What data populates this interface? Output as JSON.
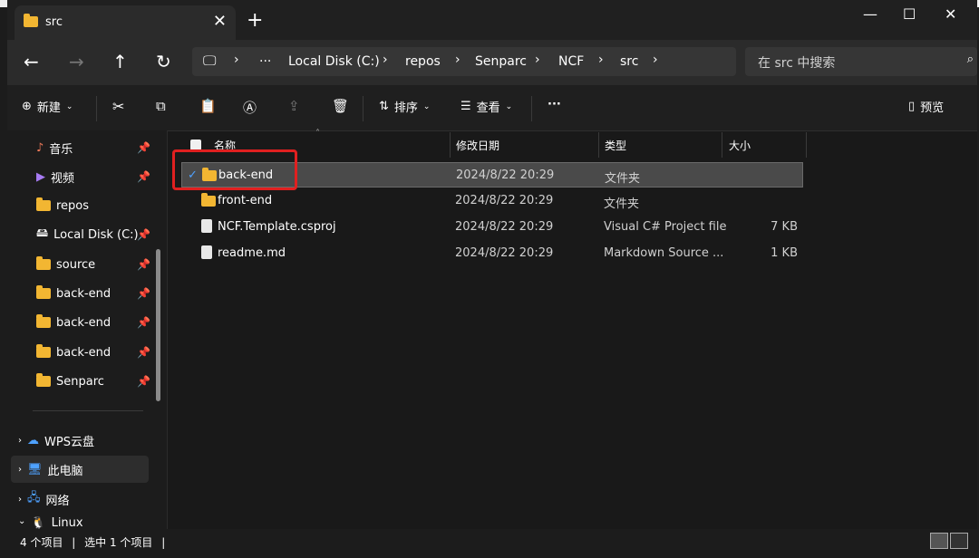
{
  "tab": {
    "title": "src"
  },
  "address": {
    "crumbs": [
      "Local Disk (C:)",
      "repos",
      "Senparc",
      "NCF",
      "src"
    ],
    "more": "···"
  },
  "search": {
    "placeholder": "在 src 中搜索"
  },
  "toolbar": {
    "new_label": "新建",
    "sort_label": "排序",
    "view_label": "查看",
    "more_label": "···",
    "preview_label": "预览"
  },
  "sidebar": {
    "items": [
      {
        "label": "音乐",
        "icon": "music-icon"
      },
      {
        "label": "视频",
        "icon": "video-icon"
      },
      {
        "label": "repos",
        "icon": "folder-icon"
      },
      {
        "label": "Local Disk (C:)",
        "icon": "drive-icon"
      },
      {
        "label": "source",
        "icon": "folder-icon"
      },
      {
        "label": "back-end",
        "icon": "folder-icon"
      },
      {
        "label": "back-end",
        "icon": "folder-icon"
      },
      {
        "label": "back-end",
        "icon": "folder-icon"
      },
      {
        "label": "Senparc",
        "icon": "folder-icon"
      }
    ],
    "lower": [
      {
        "label": "WPS云盘",
        "icon": "cloud-icon"
      },
      {
        "label": "此电脑",
        "icon": "computer-icon"
      },
      {
        "label": "网络",
        "icon": "network-icon"
      },
      {
        "label": "Linux",
        "icon": "linux-icon"
      }
    ]
  },
  "columns": {
    "name": "名称",
    "date": "修改日期",
    "type": "类型",
    "size": "大小"
  },
  "files": [
    {
      "name": "back-end",
      "date": "2024/8/22 20:29",
      "type": "文件夹",
      "size": "",
      "selected": true
    },
    {
      "name": "front-end",
      "date": "2024/8/22 20:29",
      "type": "文件夹",
      "size": ""
    },
    {
      "name": "NCF.Template.csproj",
      "date": "2024/8/22 20:29",
      "type": "Visual C# Project file",
      "size": "7 KB"
    },
    {
      "name": "readme.md",
      "date": "2024/8/22 20:29",
      "type": "Markdown Source ...",
      "size": "1 KB"
    }
  ],
  "status": {
    "count": "4 个项目",
    "selected": "选中 1 个项目"
  },
  "colors": {
    "folder": "#f2b632",
    "highlight": "#e02020",
    "bg": "#191919"
  }
}
